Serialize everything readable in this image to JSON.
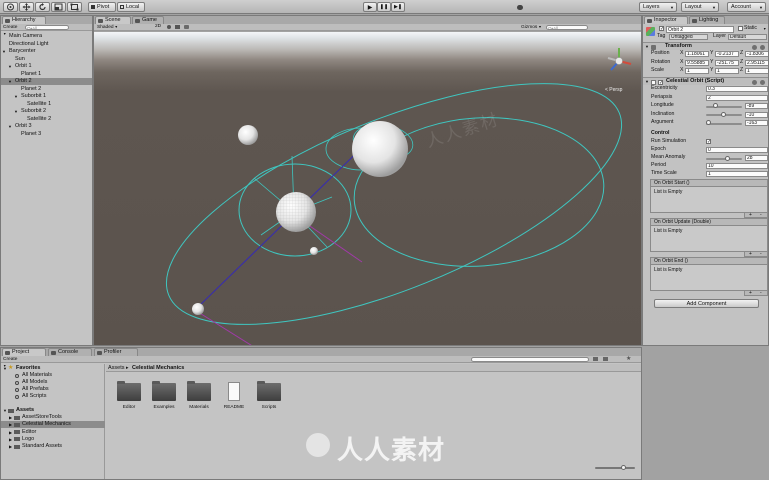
{
  "toolbar": {
    "tools": [
      "hand-tool",
      "move-tool",
      "rotate-tool",
      "scale-tool",
      "rect-tool"
    ],
    "pivot_label": "Pivot",
    "local_label": "Local",
    "play": "▶",
    "pause": "❚❚",
    "step": "▶❚",
    "layers_label": "Layers",
    "layout_label": "Layout",
    "account_label": "Account"
  },
  "hierarchy": {
    "tab": "Hierarchy",
    "create": "Create",
    "search_placeholder": "Q•All",
    "items": [
      {
        "label": "Main Camera",
        "indent": 0,
        "arrow": ""
      },
      {
        "label": "Directional Light",
        "indent": 0,
        "arrow": ""
      },
      {
        "label": "Barycenter",
        "indent": 0,
        "arrow": "▼"
      },
      {
        "label": "Sun",
        "indent": 1,
        "arrow": ""
      },
      {
        "label": "Orbit 1",
        "indent": 1,
        "arrow": "▼"
      },
      {
        "label": "Planet 1",
        "indent": 2,
        "arrow": ""
      },
      {
        "label": "Orbit 2",
        "indent": 1,
        "arrow": "▼",
        "selected": true
      },
      {
        "label": "Planet 2",
        "indent": 2,
        "arrow": ""
      },
      {
        "label": "Suborbit 1",
        "indent": 2,
        "arrow": "▼"
      },
      {
        "label": "Satellite 1",
        "indent": 3,
        "arrow": ""
      },
      {
        "label": "Suborbit 2",
        "indent": 2,
        "arrow": "▼"
      },
      {
        "label": "Satellite 2",
        "indent": 3,
        "arrow": ""
      },
      {
        "label": "Orbit 3",
        "indent": 1,
        "arrow": "▼"
      },
      {
        "label": "Planet 3",
        "indent": 2,
        "arrow": ""
      }
    ]
  },
  "scene": {
    "tab_scene": "Scene",
    "tab_game": "Game",
    "shaded": "Shaded",
    "mode_2d": "2D",
    "gizmos": "Gizmos",
    "search_placeholder": "Q•All",
    "persp": "< Persp"
  },
  "inspector": {
    "tab_inspector": "Inspector",
    "tab_lighting": "Lighting",
    "object_name": "Orbit 2",
    "static_label": "Static",
    "tag_label": "Tag",
    "tag_value": "Untagged",
    "layer_label": "Layer",
    "layer_value": "Default",
    "transform": {
      "title": "Transform",
      "position_label": "Position",
      "position": {
        "x": "1.18061",
        "y": "-0.2137",
        "z": "-1.8306"
      },
      "rotation_label": "Rotation",
      "rotation": {
        "x": "9.55885",
        "y": "-251.75",
        "z": "2.95115"
      },
      "scale_label": "Scale",
      "scale": {
        "x": "1",
        "y": "1",
        "z": "1"
      }
    },
    "orbit": {
      "title": "Celestial Orbit (Script)",
      "fields": [
        {
          "label": "Eccentricity",
          "value": "0.3",
          "slider": null
        },
        {
          "label": "Periapsis",
          "value": "2",
          "slider": null
        },
        {
          "label": "Longitude",
          "value": "-89",
          "slider": 0.25
        },
        {
          "label": "Inclination",
          "value": "-10",
          "slider": 0.47
        },
        {
          "label": "Argument",
          "value": "-163",
          "slider": 0.05
        }
      ],
      "control_label": "Control",
      "run_simulation_label": "Run Simulation",
      "run_simulation": true,
      "epoch_label": "Epoch",
      "epoch": "0",
      "mean_anomaly_label": "Mean Anomaly",
      "mean_anomaly": "28",
      "mean_anomaly_slider": 0.58,
      "period_label": "Period",
      "period": "10",
      "time_scale_label": "Time Scale",
      "time_scale": "1",
      "events": [
        {
          "title": "On Orbit Start ()",
          "empty": "List is Empty"
        },
        {
          "title": "On Orbit Update (Double)",
          "empty": "List is Empty"
        },
        {
          "title": "On Orbit End ()",
          "empty": "List is Empty"
        }
      ]
    },
    "add_component": "Add Component"
  },
  "project": {
    "tab_project": "Project",
    "tab_console": "Console",
    "tab_profiler": "Profiler",
    "create": "Create",
    "favorites_label": "Favorites",
    "favorites": [
      "All Materials",
      "All Models",
      "All Prefabs",
      "All Scripts"
    ],
    "assets_label": "Assets",
    "asset_tree": [
      {
        "label": "AssetStoreTools",
        "selected": false
      },
      {
        "label": "Celestial Mechanics",
        "selected": true
      },
      {
        "label": "Editor",
        "selected": false
      },
      {
        "label": "Logo",
        "selected": false
      },
      {
        "label": "Standard Assets",
        "selected": false
      }
    ],
    "breadcrumb_root": "Assets",
    "breadcrumb_sep": "▸",
    "breadcrumb_current": "Celestial Mechanics",
    "files": [
      {
        "label": "Editor",
        "kind": "folder"
      },
      {
        "label": "Examples",
        "kind": "folder"
      },
      {
        "label": "Materials",
        "kind": "folder"
      },
      {
        "label": "README",
        "kind": "file"
      },
      {
        "label": "Scripts",
        "kind": "folder"
      }
    ]
  },
  "watermark": "人人素材",
  "colors": {
    "orbit_line": "#3fc6c0",
    "axis_line": "#3a2fa8",
    "periapsis_line": "#a03aa8",
    "scene_ground": "#5e5650",
    "selection": "#8c8c8c"
  }
}
